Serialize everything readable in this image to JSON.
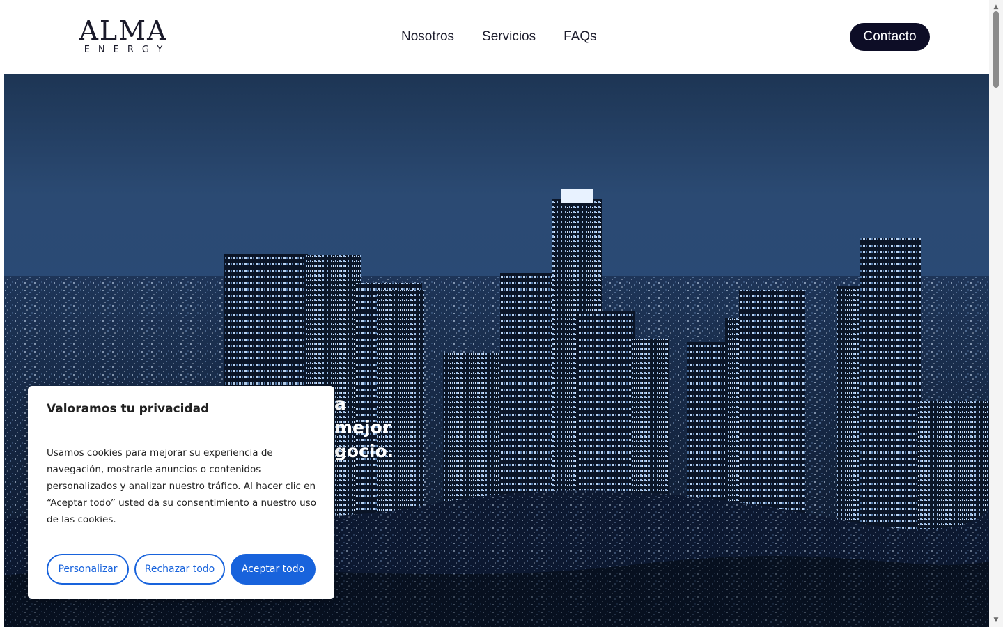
{
  "brand": {
    "name": "ALMA",
    "tagline": "ENERGY"
  },
  "nav": {
    "items": [
      {
        "label": "Nosotros"
      },
      {
        "label": "Servicios"
      },
      {
        "label": "FAQs"
      }
    ],
    "contact_label": "Contacto"
  },
  "hero": {
    "headline_visible": "a mejor gocio."
  },
  "cookie_banner": {
    "title": "Valoramos tu privacidad",
    "body": "Usamos cookies para mejorar su experiencia de navegación, mostrarle anuncios o contenidos personalizados y analizar nuestro tráfico. Al hacer clic en “Aceptar todo” usted da su consentimiento a nuestro uso de las cookies.",
    "customize_label": "Personalizar",
    "reject_label": "Rechazar todo",
    "accept_label": "Aceptar todo"
  },
  "colors": {
    "brand_dark": "#0d0d26",
    "cookie_accent": "#1863dc"
  }
}
